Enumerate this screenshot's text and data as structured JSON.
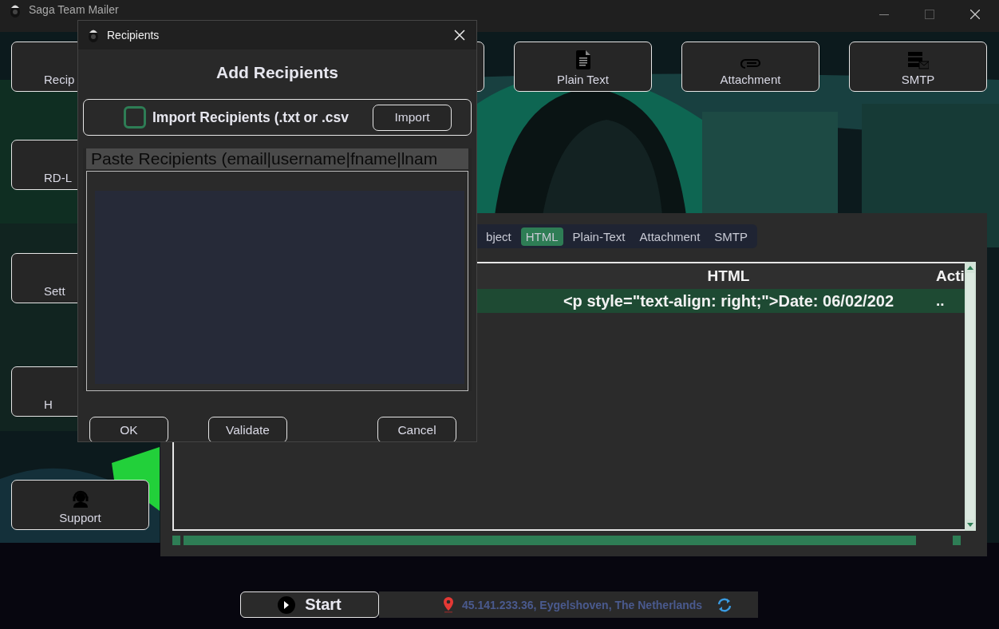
{
  "window": {
    "title": "Saga Team Mailer"
  },
  "top_buttons": [
    {
      "label": "Recip",
      "kind": "covered"
    },
    {
      "label": "Plain Text",
      "kind": "document"
    },
    {
      "label": "Attachment",
      "kind": "clip"
    },
    {
      "label": "SMTP",
      "kind": "server"
    }
  ],
  "side_buttons": [
    {
      "label": "RD-L",
      "kind": "covered"
    },
    {
      "label": "Sett",
      "kind": "covered"
    },
    {
      "label": "H",
      "kind": "covered"
    },
    {
      "label": "Support",
      "kind": "headset"
    }
  ],
  "tabs": [
    {
      "label": "bject",
      "selected": false
    },
    {
      "label": "HTML",
      "selected": true
    },
    {
      "label": "Plain-Text",
      "selected": false
    },
    {
      "label": "Attachment",
      "selected": false
    },
    {
      "label": "SMTP",
      "selected": false
    }
  ],
  "table": {
    "columns": [
      "HTML",
      "Acti"
    ],
    "rows": [
      {
        "cells": [
          "<p style=\"text-align: right;\">Date: 06/02/202",
          ".."
        ],
        "selected": true
      }
    ]
  },
  "footer": {
    "start_button": "Start",
    "location": "45.141.233.36, Eygelshoven, The Netherlands"
  },
  "dialog": {
    "title": "Recipients",
    "heading": "Add Recipients",
    "import": {
      "label": "Import Recipients (.txt or .csv",
      "checked": false,
      "button": "Import"
    },
    "paste": {
      "label": "Paste Recipients (email|username|fname|lnam"
    },
    "buttons": [
      "OK",
      "Validate",
      "Cancel"
    ]
  }
}
